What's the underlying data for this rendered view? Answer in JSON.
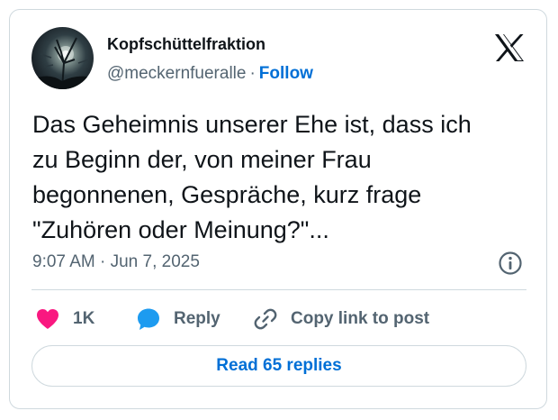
{
  "author": {
    "display_name": "Kopfschüttelfraktion",
    "handle": "@meckernfueralle",
    "separator": "·",
    "follow_label": "Follow"
  },
  "tweet": {
    "lines": [
      "Das Geheimnis unserer Ehe ist, dass ich",
      "zu Beginn der, von meiner Frau",
      "begonnenen, Gespräche, kurz frage",
      "\"Zuhören oder Meinung?\"..."
    ],
    "timestamp": "9:07 AM · Jun 7, 2025"
  },
  "actions": {
    "like_count": "1K",
    "reply_label": "Reply",
    "copy_label": "Copy link to post"
  },
  "footer": {
    "read_replies_label": "Read 65 replies"
  },
  "icons": {
    "logo": "x-logo-icon",
    "info": "info-icon",
    "like": "heart-icon",
    "reply": "speech-bubble-icon",
    "copy": "link-icon"
  },
  "colors": {
    "like": "#f91880",
    "reply": "#1d9bf0",
    "link": "#006fd6",
    "muted": "#536471",
    "text": "#0f1419",
    "border": "#cfd9de"
  }
}
